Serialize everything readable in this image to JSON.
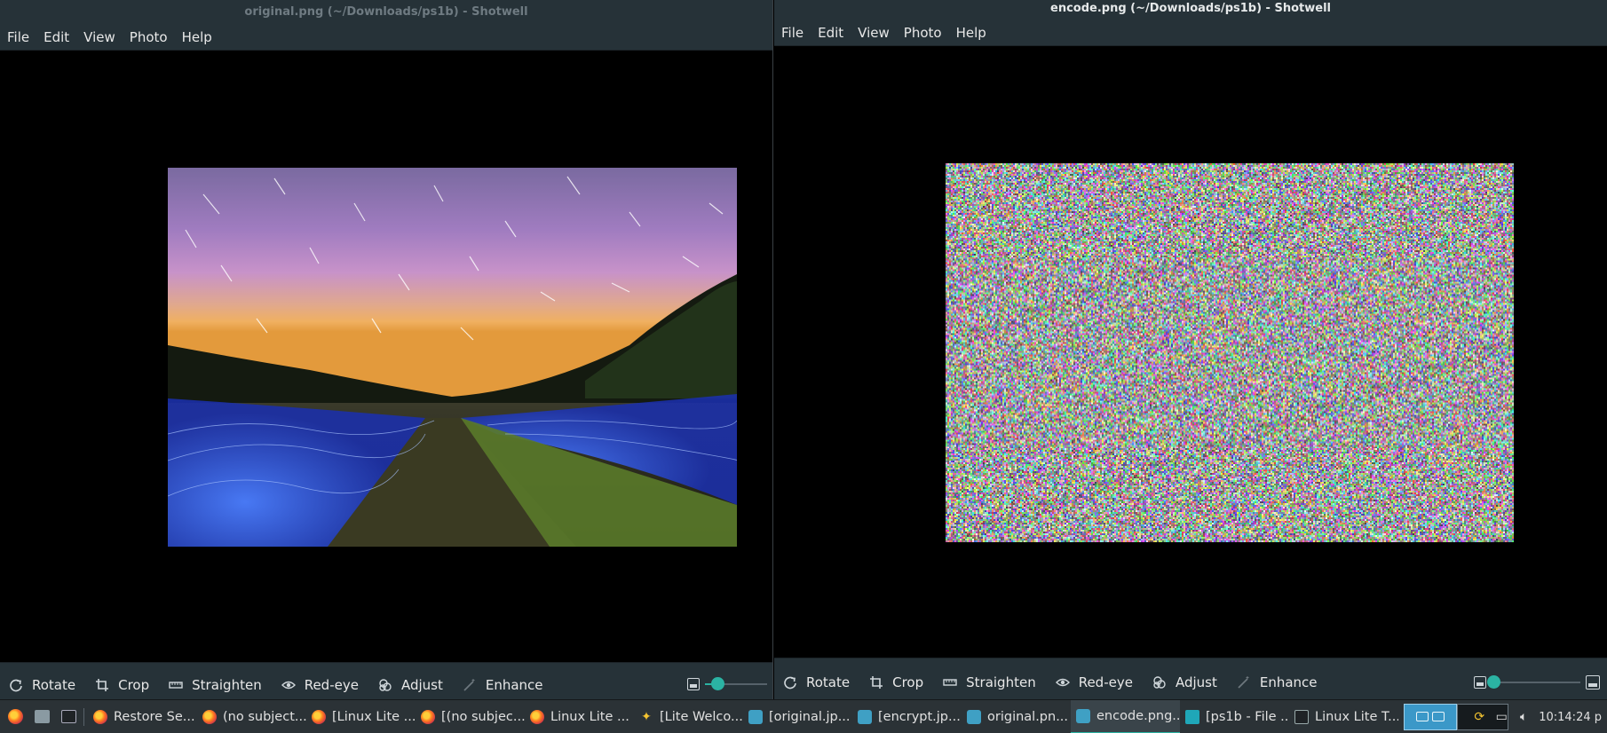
{
  "left_window": {
    "title": "original.png (~/Downloads/ps1b) - Shotwell",
    "menu": [
      "File",
      "Edit",
      "View",
      "Photo",
      "Help"
    ],
    "toolbar": [
      "Rotate",
      "Crop",
      "Straighten",
      "Red-eye",
      "Adjust",
      "Enhance"
    ],
    "zoom_level": 0.2
  },
  "right_window": {
    "title": "encode.png (~/Downloads/ps1b) - Shotwell",
    "menu": [
      "File",
      "Edit",
      "View",
      "Photo",
      "Help"
    ],
    "toolbar": [
      "Rotate",
      "Crop",
      "Straighten",
      "Red-eye",
      "Adjust",
      "Enhance"
    ],
    "zoom_level": 0.02
  },
  "taskbar": {
    "tasks": [
      {
        "label": "Restore Se...",
        "icon": "firefox-icon",
        "active": false
      },
      {
        "label": "(no subject...",
        "icon": "firefox-icon",
        "active": false
      },
      {
        "label": "[Linux Lite ...",
        "icon": "firefox-icon",
        "active": false
      },
      {
        "label": "[(no subjec...",
        "icon": "firefox-icon",
        "active": false
      },
      {
        "label": "Linux Lite ...",
        "icon": "firefox-icon",
        "active": false
      },
      {
        "label": "[Lite Welco...",
        "icon": "lite-icon",
        "active": false
      },
      {
        "label": "[original.jp...",
        "icon": "shotwell-icon",
        "active": false
      },
      {
        "label": "[encrypt.jp...",
        "icon": "shotwell-icon",
        "active": false
      },
      {
        "label": "original.pn...",
        "icon": "shotwell-icon",
        "active": false
      },
      {
        "label": "encode.png...",
        "icon": "shotwell-icon",
        "active": true
      },
      {
        "label": "[ps1b - File ...",
        "icon": "folder-icon",
        "active": false
      },
      {
        "label": "Linux Lite T...",
        "icon": "terminal-icon",
        "active": false
      }
    ],
    "clock": "10:14:24 p"
  },
  "colors": {
    "chrome": "#263238",
    "accent": "#2bb3a3",
    "taskbar": "#2b3236"
  }
}
